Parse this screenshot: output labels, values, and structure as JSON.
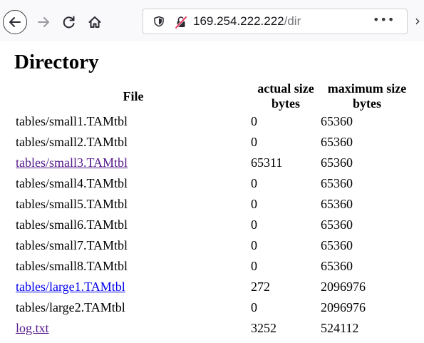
{
  "browser": {
    "url_host": "169.254.222.222",
    "url_path": "/dir",
    "more_label": "•••",
    "overflow_label": "›"
  },
  "page": {
    "heading": "Directory",
    "columns": {
      "file": "File",
      "actual_line1": "actual size",
      "actual_line2": "bytes",
      "max_line1": "maximum size",
      "max_line2": "bytes"
    },
    "rows": [
      {
        "file": "tables/small1.TAMtbl",
        "actual": "0",
        "max": "65360",
        "link": "none"
      },
      {
        "file": "tables/small2.TAMtbl",
        "actual": "0",
        "max": "65360",
        "link": "none"
      },
      {
        "file": "tables/small3.TAMtbl",
        "actual": "65311",
        "max": "65360",
        "link": "visited"
      },
      {
        "file": "tables/small4.TAMtbl",
        "actual": "0",
        "max": "65360",
        "link": "none"
      },
      {
        "file": "tables/small5.TAMtbl",
        "actual": "0",
        "max": "65360",
        "link": "none"
      },
      {
        "file": "tables/small6.TAMtbl",
        "actual": "0",
        "max": "65360",
        "link": "none"
      },
      {
        "file": "tables/small7.TAMtbl",
        "actual": "0",
        "max": "65360",
        "link": "none"
      },
      {
        "file": "tables/small8.TAMtbl",
        "actual": "0",
        "max": "65360",
        "link": "none"
      },
      {
        "file": "tables/large1.TAMtbl",
        "actual": "272",
        "max": "2096976",
        "link": "unvisited"
      },
      {
        "file": "tables/large2.TAMtbl",
        "actual": "0",
        "max": "2096976",
        "link": "none"
      },
      {
        "file": "log.txt",
        "actual": "3252",
        "max": "524112",
        "link": "visited"
      }
    ]
  },
  "colors": {
    "link_visited": "#551a8b",
    "link_unvisited": "#0000ee",
    "insecure_slash": "#e22850"
  },
  "icons": {
    "back": "back-arrow-icon",
    "forward": "forward-arrow-icon",
    "reload": "reload-icon",
    "home": "home-icon",
    "tracking_protection": "shield-icon",
    "insecure": "insecure-lock-icon",
    "page_actions": "more-horizontal-icon",
    "overflow": "chevron-right-icon"
  }
}
